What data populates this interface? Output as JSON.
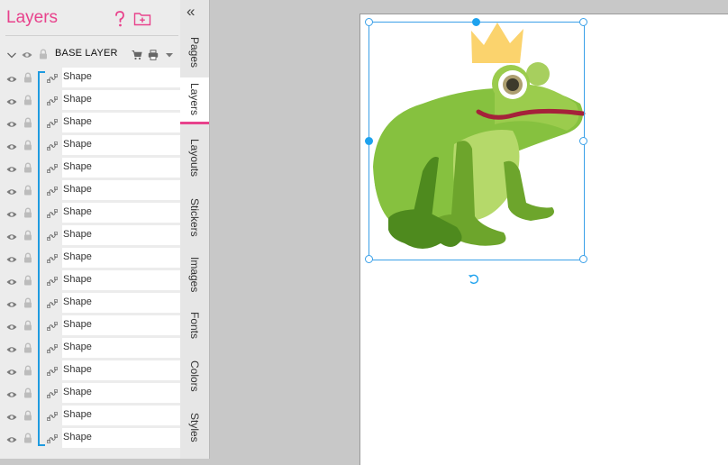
{
  "panel": {
    "title": "Layers",
    "help_icon": "help-question-icon",
    "add_folder_icon": "add-folder-icon"
  },
  "base_layer": {
    "label": "BASE LAYER",
    "icons": [
      "chevron-down-icon",
      "eye-icon",
      "lock-icon",
      "cart-icon",
      "printer-icon",
      "dropdown-caret-icon"
    ]
  },
  "layers": [
    {
      "name": "Shape"
    },
    {
      "name": "Shape"
    },
    {
      "name": "Shape"
    },
    {
      "name": "Shape"
    },
    {
      "name": "Shape"
    },
    {
      "name": "Shape"
    },
    {
      "name": "Shape"
    },
    {
      "name": "Shape"
    },
    {
      "name": "Shape"
    },
    {
      "name": "Shape"
    },
    {
      "name": "Shape"
    },
    {
      "name": "Shape"
    },
    {
      "name": "Shape"
    },
    {
      "name": "Shape"
    },
    {
      "name": "Shape"
    },
    {
      "name": "Shape"
    },
    {
      "name": "Shape"
    }
  ],
  "tabs": [
    {
      "label": "Pages",
      "active": false
    },
    {
      "label": "Layers",
      "active": true
    },
    {
      "label": "Layouts",
      "active": false
    },
    {
      "label": "Stickers",
      "active": false
    },
    {
      "label": "Images",
      "active": false
    },
    {
      "label": "Fonts",
      "active": false
    },
    {
      "label": "Colors",
      "active": false
    },
    {
      "label": "Styles",
      "active": false
    }
  ],
  "collapse_glyph": "«",
  "colors": {
    "accent_pink": "#e8428c",
    "selection_blue": "#1ea2ee"
  }
}
